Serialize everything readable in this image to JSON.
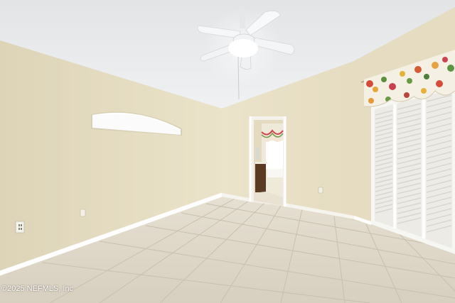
{
  "photo": {
    "room": "empty bedroom",
    "features": [
      "ceiling fan",
      "arched transom window",
      "open doorway to bathroom",
      "plantation shutter doors",
      "floral valance",
      "tile floor",
      "wall outlets"
    ]
  },
  "colors": {
    "ceiling": "#eaecee",
    "left_wall": "#e4dcc2",
    "back_wall": "#ece4cb",
    "right_wall": "#e6dcc0",
    "floor": "#dcd5c6",
    "grout": "#c7bfae",
    "baseboard": "#ffffff",
    "shutter": "#f7f7f5",
    "valance_base": "#f4f0e4",
    "vanity": "#5a3a22"
  },
  "watermark": {
    "text": "©2025 NEFMLS, Inc"
  }
}
